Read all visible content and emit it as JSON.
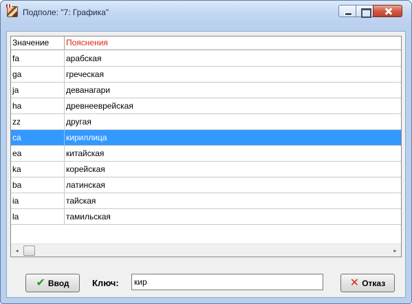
{
  "window": {
    "title": "Подполе: \"7: Графика\""
  },
  "grid": {
    "columns": [
      "Значение",
      "Пояснения"
    ],
    "rows": [
      {
        "value": "fa",
        "description": "арабская"
      },
      {
        "value": "ga",
        "description": "греческая"
      },
      {
        "value": "ja",
        "description": "деванагари"
      },
      {
        "value": "ha",
        "description": "древнееврейская"
      },
      {
        "value": "zz",
        "description": "другая"
      },
      {
        "value": "ca",
        "description": "кириллица",
        "selected": true
      },
      {
        "value": "ea",
        "description": "китайская"
      },
      {
        "value": "ka",
        "description": "корейская"
      },
      {
        "value": "ba",
        "description": "латинская"
      },
      {
        "value": "ia",
        "description": "тайская"
      },
      {
        "value": "la",
        "description": "тамильская"
      }
    ],
    "scrollbar": {
      "left_arrow": "◂",
      "right_arrow": "▸"
    }
  },
  "footer": {
    "ok_label": "Ввод",
    "ok_icon": "checkmark-icon",
    "key_label": "Ключ:",
    "key_value": "кир",
    "cancel_label": "Отказ",
    "cancel_icon": "x-icon"
  },
  "colors": {
    "selection": "#3399ff",
    "header_desc": "#e0221a",
    "ok_icon": "#2a9a1a",
    "cancel_icon": "#d62a1e"
  }
}
